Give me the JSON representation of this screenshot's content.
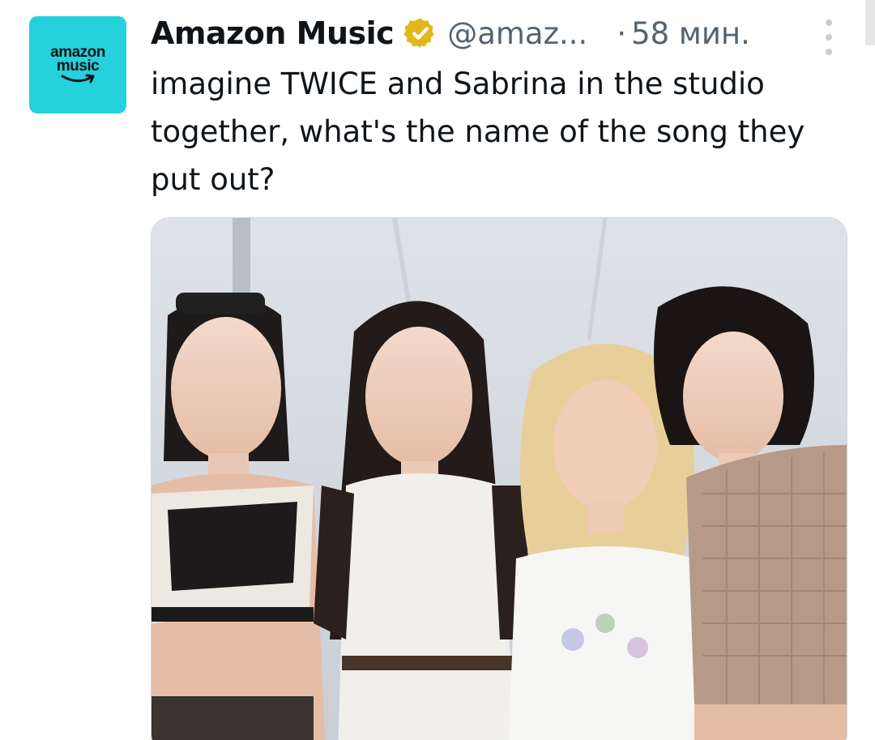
{
  "account": {
    "avatar_line1": "amazon",
    "avatar_line2": "music",
    "avatar_color": "#25d1da",
    "name": "Amazon Music",
    "verified_icon": "gold-verified-badge-icon",
    "handle": "@amaz...",
    "separator": "·",
    "time": "58 мин."
  },
  "tweet": {
    "text": "imagine TWICE and Sabrina in the studio together, what's the name of the song they put out?"
  },
  "media": {
    "photo_icon": "photo-four-women-posing"
  },
  "colors": {
    "text": "#0f1419",
    "secondary": "#536471",
    "verified_gold": "#e2b719"
  }
}
